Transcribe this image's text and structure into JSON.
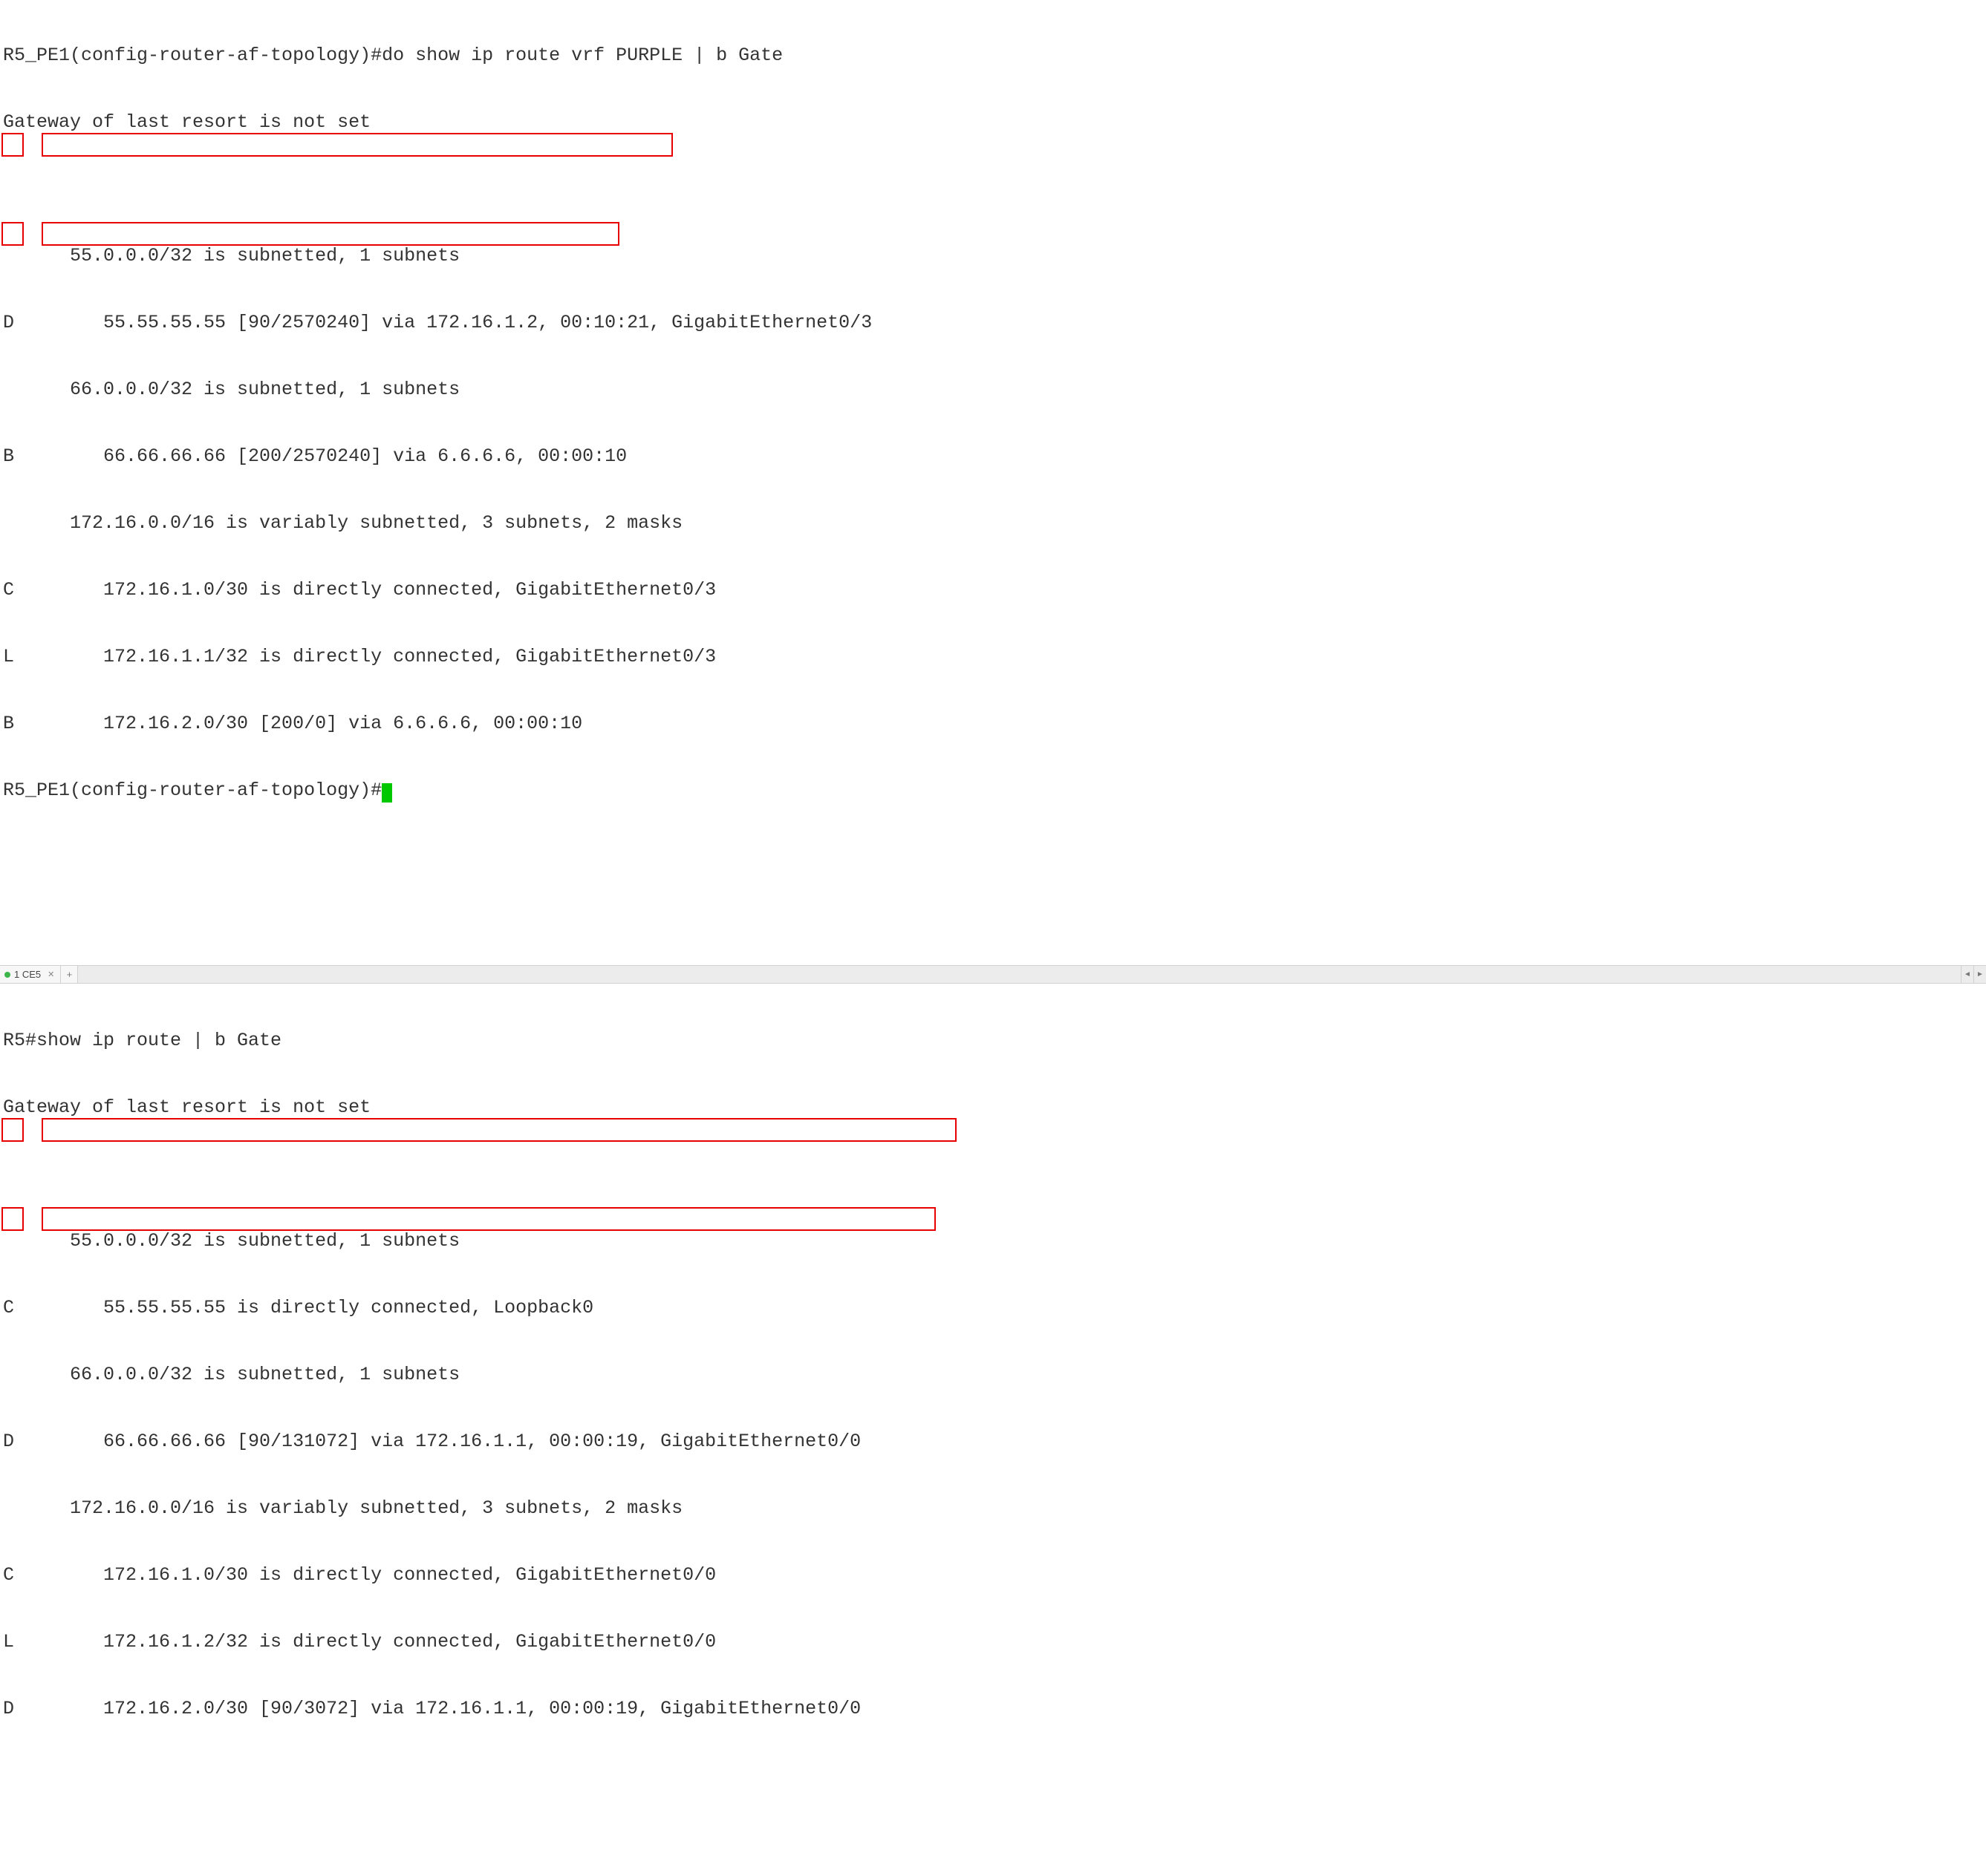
{
  "top": {
    "cmd_line": "R5_PE1(config-router-af-topology)#do show ip route vrf PURPLE | b Gate",
    "gateway": "Gateway of last resort is not set",
    "blank1": "",
    "l1": "      55.0.0.0/32 is subnetted, 1 subnets",
    "l2": "D        55.55.55.55 [90/2570240] via 172.16.1.2, 00:10:21, GigabitEthernet0/3",
    "l3": "      66.0.0.0/32 is subnetted, 1 subnets",
    "l4": "B        66.66.66.66 [200/2570240] via 6.6.6.6, 00:00:10",
    "l5": "      172.16.0.0/16 is variably subnetted, 3 subnets, 2 masks",
    "l6": "C        172.16.1.0/30 is directly connected, GigabitEthernet0/3",
    "l7": "L        172.16.1.1/32 is directly connected, GigabitEthernet0/3",
    "l8": "B        172.16.2.0/30 [200/0] via 6.6.6.6, 00:00:10",
    "prompt_end": "R5_PE1(config-router-af-topology)#"
  },
  "tab": {
    "label": "1 CE5"
  },
  "bottom": {
    "cmd_line": "R5#show ip route | b Gate",
    "gateway": "Gateway of last resort is not set",
    "blank1": "",
    "l1": "      55.0.0.0/32 is subnetted, 1 subnets",
    "l2": "C        55.55.55.55 is directly connected, Loopback0",
    "l3": "      66.0.0.0/32 is subnetted, 1 subnets",
    "l4": "D        66.66.66.66 [90/131072] via 172.16.1.1, 00:00:19, GigabitEthernet0/0",
    "l5": "      172.16.0.0/16 is variably subnetted, 3 subnets, 2 masks",
    "l6": "C        172.16.1.0/30 is directly connected, GigabitEthernet0/0",
    "l7": "L        172.16.1.2/32 is directly connected, GigabitEthernet0/0",
    "l8": "D        172.16.2.0/30 [90/3072] via 172.16.1.1, 00:00:19, GigabitEthernet0/0"
  }
}
